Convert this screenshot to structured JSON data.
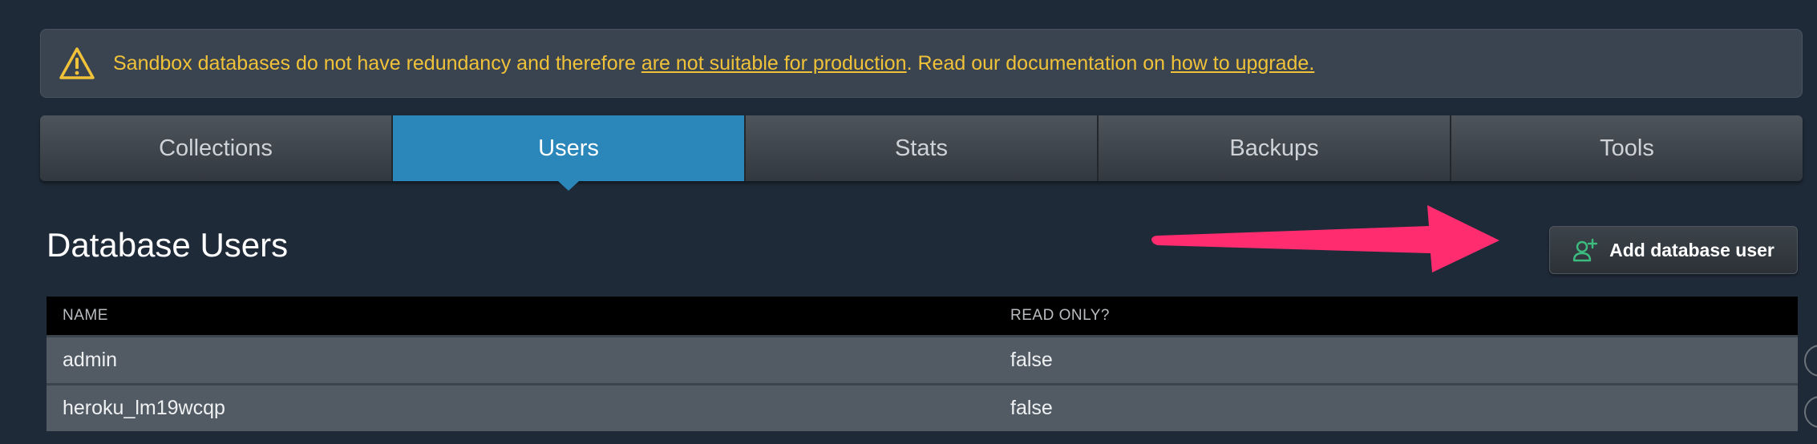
{
  "warning": {
    "text_before": "Sandbox databases do not have redundancy and therefore ",
    "link1": "are not suitable for production",
    "text_middle": ". Read our documentation on ",
    "link2": "how to upgrade."
  },
  "tabs": [
    {
      "label": "Collections",
      "active": false
    },
    {
      "label": "Users",
      "active": true
    },
    {
      "label": "Stats",
      "active": false
    },
    {
      "label": "Backups",
      "active": false
    },
    {
      "label": "Tools",
      "active": false
    }
  ],
  "page_title": "Database Users",
  "add_button": {
    "label": "Add database user",
    "icon": "add-user-icon",
    "icon_color": "#3dbb7e"
  },
  "annotation": {
    "icon": "pointer-arrow",
    "color": "#ff2d6f"
  },
  "table": {
    "columns": [
      "NAME",
      "READ ONLY?"
    ],
    "rows": [
      {
        "name": "admin",
        "read_only": "false"
      },
      {
        "name": "heroku_lm19wcqp",
        "read_only": "false"
      }
    ]
  },
  "colors": {
    "background": "#1f2a38",
    "warning_text": "#f0c23a",
    "active_tab": "#2b87ba"
  }
}
